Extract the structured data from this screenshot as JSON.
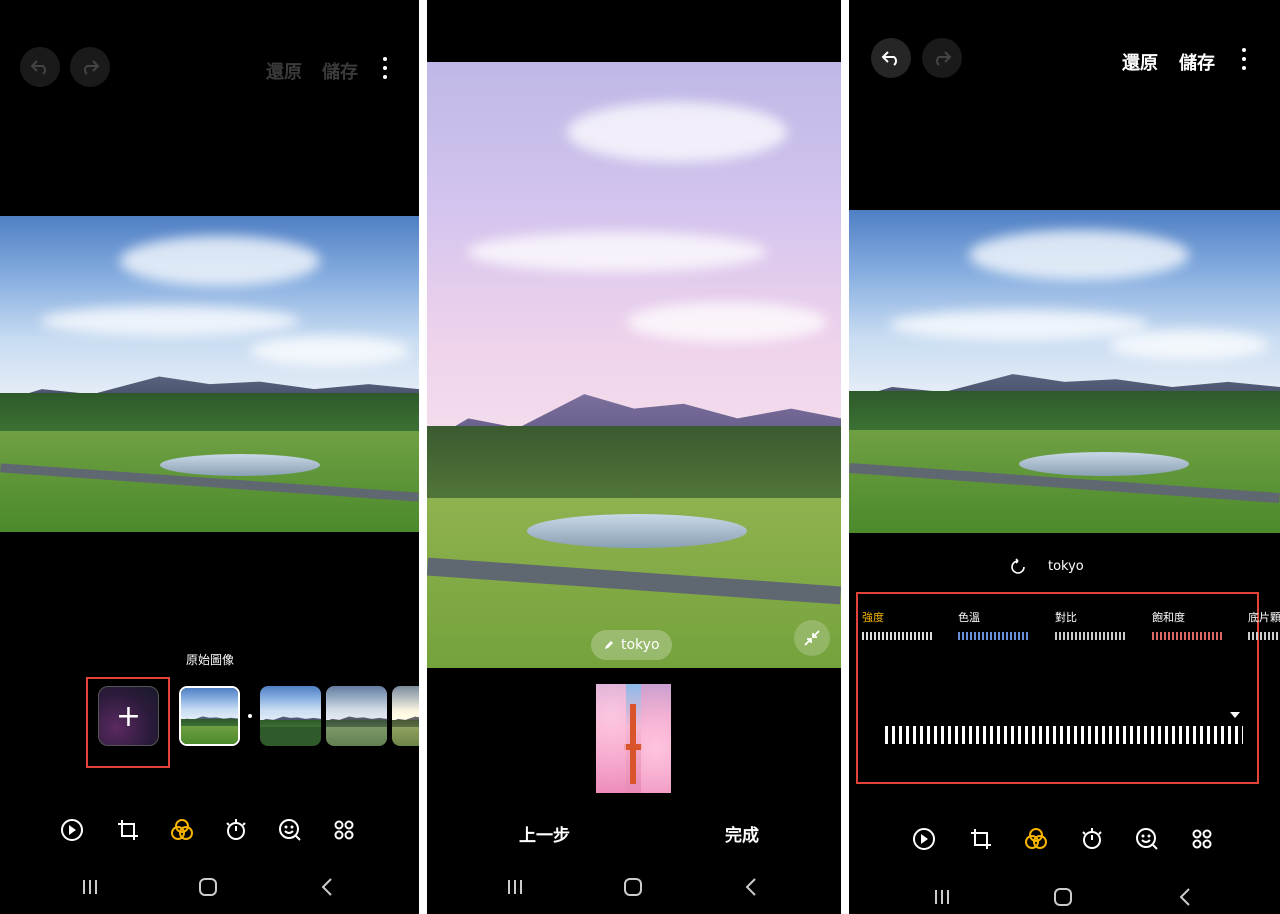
{
  "panel1": {
    "header": {
      "revert_label": "還原",
      "save_label": "儲存"
    },
    "filters": {
      "section_label": "原始圖像"
    }
  },
  "panel2": {
    "filter_chip": "tokyo",
    "back_label": "上一步",
    "done_label": "完成"
  },
  "panel3": {
    "header": {
      "revert_label": "還原",
      "save_label": "儲存"
    },
    "filter_name": "tokyo",
    "adjust_tabs": [
      {
        "label": "強度",
        "active": true
      },
      {
        "label": "色溫",
        "active": false
      },
      {
        "label": "對比",
        "active": false
      },
      {
        "label": "飽和度",
        "active": false
      },
      {
        "label": "底片顆",
        "active": false
      }
    ]
  },
  "colors": {
    "accent": "#f5b400",
    "highlight_box": "#e2443a",
    "inactive_header": "#3a3a3a"
  },
  "icons": {
    "toolbar": [
      "play-icon",
      "crop-rotate-icon",
      "filter-icon",
      "brightness-icon",
      "sticker-icon",
      "more-tools-icon"
    ],
    "nav": [
      "recents-icon",
      "home-icon",
      "back-icon"
    ]
  }
}
